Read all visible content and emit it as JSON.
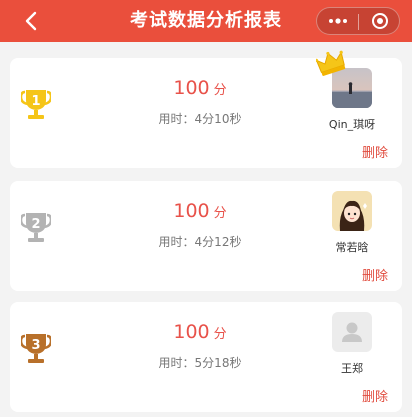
{
  "header": {
    "title": "考试数据分析报表",
    "back_icon": "chevron-left-icon",
    "more_icon": "more-dots-icon",
    "close_icon": "target-close-icon",
    "bg_color": "#ea4f3c"
  },
  "records": [
    {
      "rank": "1",
      "medal": "gold",
      "score": "100",
      "score_unit": "分",
      "time": "用时：4分10秒",
      "name": "Qin_琪呀",
      "has_crown": true,
      "delete_label": "删除"
    },
    {
      "rank": "2",
      "medal": "silver",
      "score": "100",
      "score_unit": "分",
      "time": "用时：4分12秒",
      "name": "常若晗",
      "has_crown": false,
      "delete_label": "删除"
    },
    {
      "rank": "3",
      "medal": "bronze",
      "score": "100",
      "score_unit": "分",
      "time": "用时：5分18秒",
      "name": "王郑",
      "has_crown": false,
      "delete_label": "删除"
    }
  ],
  "colors": {
    "gold": "#f5c518",
    "silver": "#b3b3b3",
    "bronze": "#b8702a",
    "accent": "#e8524a"
  }
}
